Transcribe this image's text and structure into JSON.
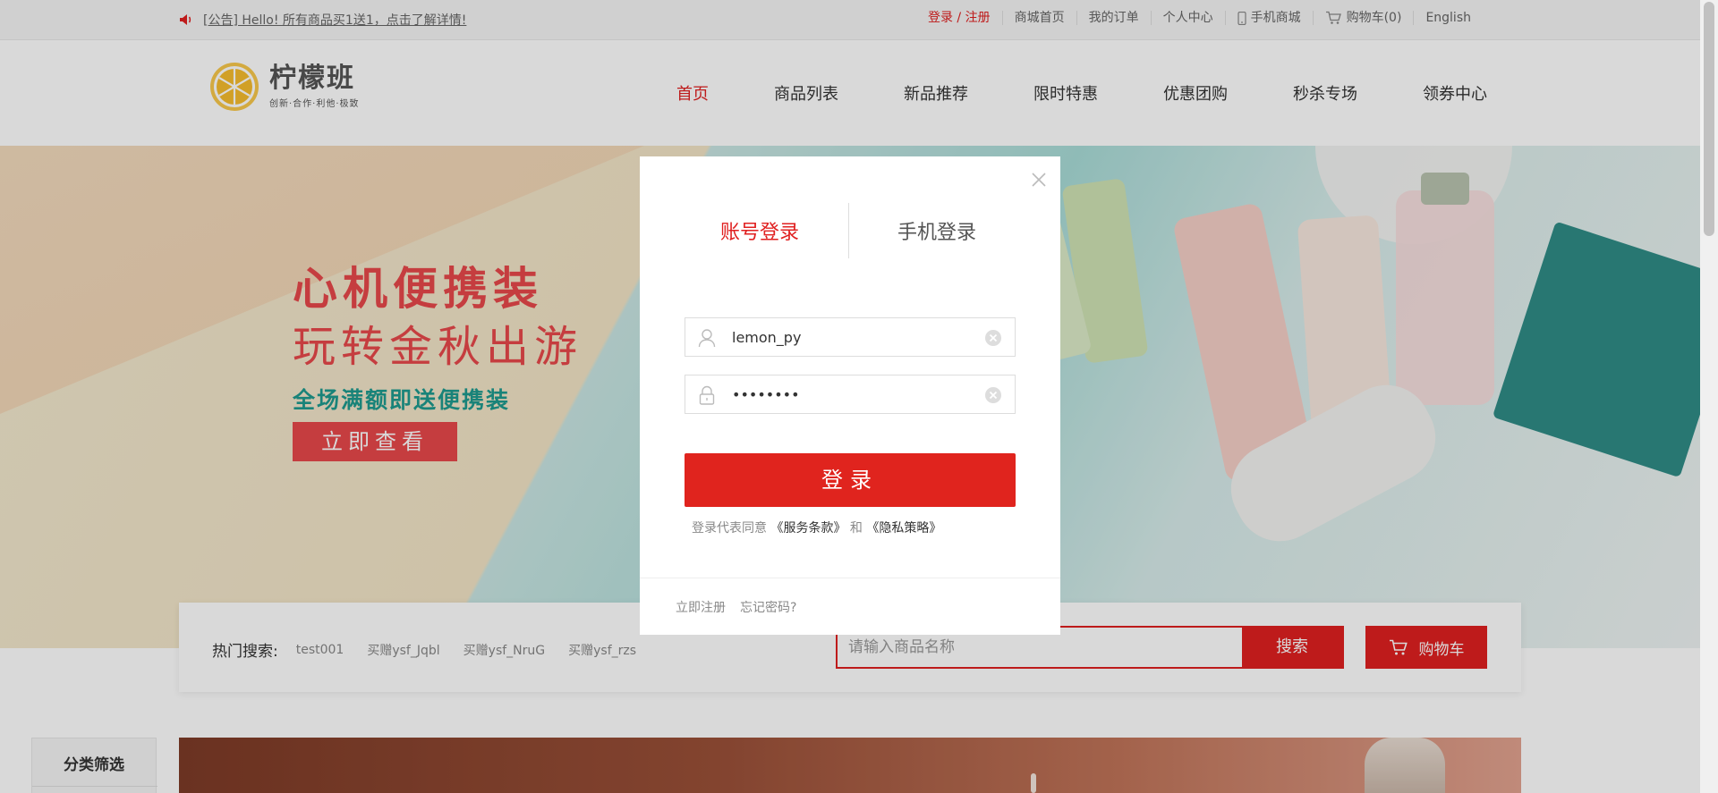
{
  "topbar": {
    "notice": "[公告] Hello! 所有商品买1送1，点击了解详情!",
    "links": [
      {
        "label": "登录 / 注册"
      },
      {
        "label": "商城首页"
      },
      {
        "label": "我的订单"
      },
      {
        "label": "个人中心"
      },
      {
        "label": "手机商城",
        "icon": "phone-icon"
      },
      {
        "label": "购物车(0)",
        "icon": "cart-icon"
      },
      {
        "label": "English"
      }
    ]
  },
  "header": {
    "logo_name": "柠檬班",
    "logo_slogan": "创新·合作·利他·极致",
    "nav": [
      "首页",
      "商品列表",
      "新品推荐",
      "限时特惠",
      "优惠团购",
      "秒杀专场",
      "领券中心"
    ]
  },
  "banner": {
    "title1": "心机便携装",
    "title2": "玩转金秋出游",
    "subtitle": "全场满额即送便携装",
    "button": "立即查看"
  },
  "search": {
    "hot_label": "热门搜索:",
    "hot_items": [
      "test001",
      "买赠ysf_Jqbl",
      "买赠ysf_NruG",
      "买赠ysf_rzs"
    ],
    "placeholder": "请输入商品名称",
    "button": "搜索",
    "cart_button": "购物车"
  },
  "sidebar": {
    "filter_title": "分类筛选"
  },
  "login_modal": {
    "tab_account": "账号登录",
    "tab_phone": "手机登录",
    "username": "lemon_py",
    "password": "••••••••",
    "login_button": "登录",
    "agree_prefix": "登录代表同意",
    "terms": "《服务条款》",
    "and": "和",
    "privacy": "《隐私策略》",
    "register": "立即注册",
    "forgot": "忘记密码?"
  },
  "colors": {
    "accent": "#e02020",
    "teal": "#1e9b8f",
    "banner_red": "#e8484a"
  }
}
